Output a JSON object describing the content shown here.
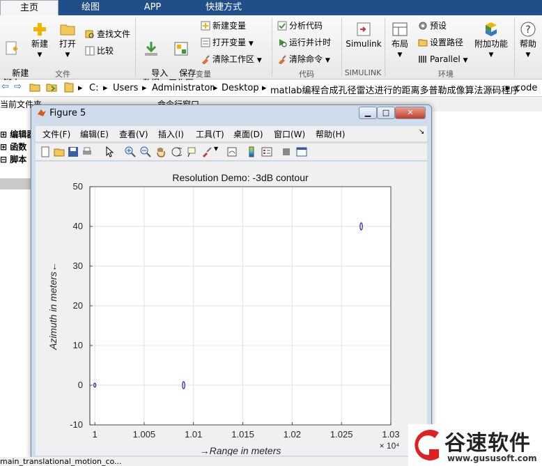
{
  "tabs": [
    {
      "label": "主页",
      "active": true
    },
    {
      "label": "绘图",
      "active": false
    },
    {
      "label": "APP",
      "active": false
    },
    {
      "label": "快捷方式",
      "active": false
    }
  ],
  "ribbon": {
    "new_script": "新建\n脚本",
    "new": "新建",
    "open": "打开",
    "find_files": "查找文件",
    "compare": "比较",
    "import_data": "导入\n数据",
    "save_workspace": "保存\n工作区",
    "new_variable": "新建变量",
    "open_variable": "打开变量",
    "clear_workspace": "清除工作区",
    "analyze_code": "分析代码",
    "run_and_time": "运行并计时",
    "clear_commands": "清除命令",
    "simulink": "Simulink",
    "layout": "布局",
    "preferences": "预设",
    "set_path": "设置路径",
    "parallel": "Parallel",
    "addons": "附加功能",
    "help": "帮助",
    "groups": {
      "file": "文件",
      "variable": "变量",
      "code": "代码",
      "simulink": "SIMULINK",
      "environment": "环境"
    }
  },
  "address": {
    "crumbs": [
      "C:",
      "Users",
      "Administrator",
      "Desktop",
      "matlab编程合成孔径雷达进行的距离多普勒成像算法源码程序",
      "code"
    ]
  },
  "left_panel": {
    "header": "当前文件夹",
    "items": [
      "编辑器",
      "函数",
      "脚本"
    ]
  },
  "command_window_label": "命令行窗口",
  "status_file": "main_translational_motion_co...",
  "figure": {
    "title": "Figure 5",
    "menus": [
      "文件(F)",
      "编辑(E)",
      "查看(V)",
      "插入(I)",
      "工具(T)",
      "桌面(D)",
      "窗口(W)",
      "帮助(H)"
    ]
  },
  "chart_data": {
    "type": "contour",
    "title": "Resolution Demo: -3dB contour",
    "xlabel": "→Range in meters",
    "ylabel": "Azimuth in meters←",
    "x_exponent_label": "× 10⁴",
    "xlim": [
      0.9995,
      1.03
    ],
    "ylim": [
      -10,
      50
    ],
    "xticks": [
      "1",
      "1.005",
      "1.01",
      "1.015",
      "1.02",
      "1.025",
      "1.03"
    ],
    "xtick_values": [
      1.0,
      1.005,
      1.01,
      1.015,
      1.02,
      1.025,
      1.03
    ],
    "yticks": [
      -10,
      0,
      10,
      20,
      30,
      40,
      50
    ],
    "grid": true,
    "color": "#1f1fb4",
    "targets": [
      {
        "x": 1.0,
        "y": 0,
        "rx": 5e-05,
        "ry": 0.5
      },
      {
        "x": 1.009,
        "y": 0,
        "rx": 0.00012,
        "ry": 0.9
      },
      {
        "x": 1.027,
        "y": 40,
        "rx": 0.00012,
        "ry": 0.9
      }
    ]
  },
  "watermark": {
    "name": "谷速软件",
    "url": "www.gususoft.com",
    "brand_color": "#e02020"
  }
}
